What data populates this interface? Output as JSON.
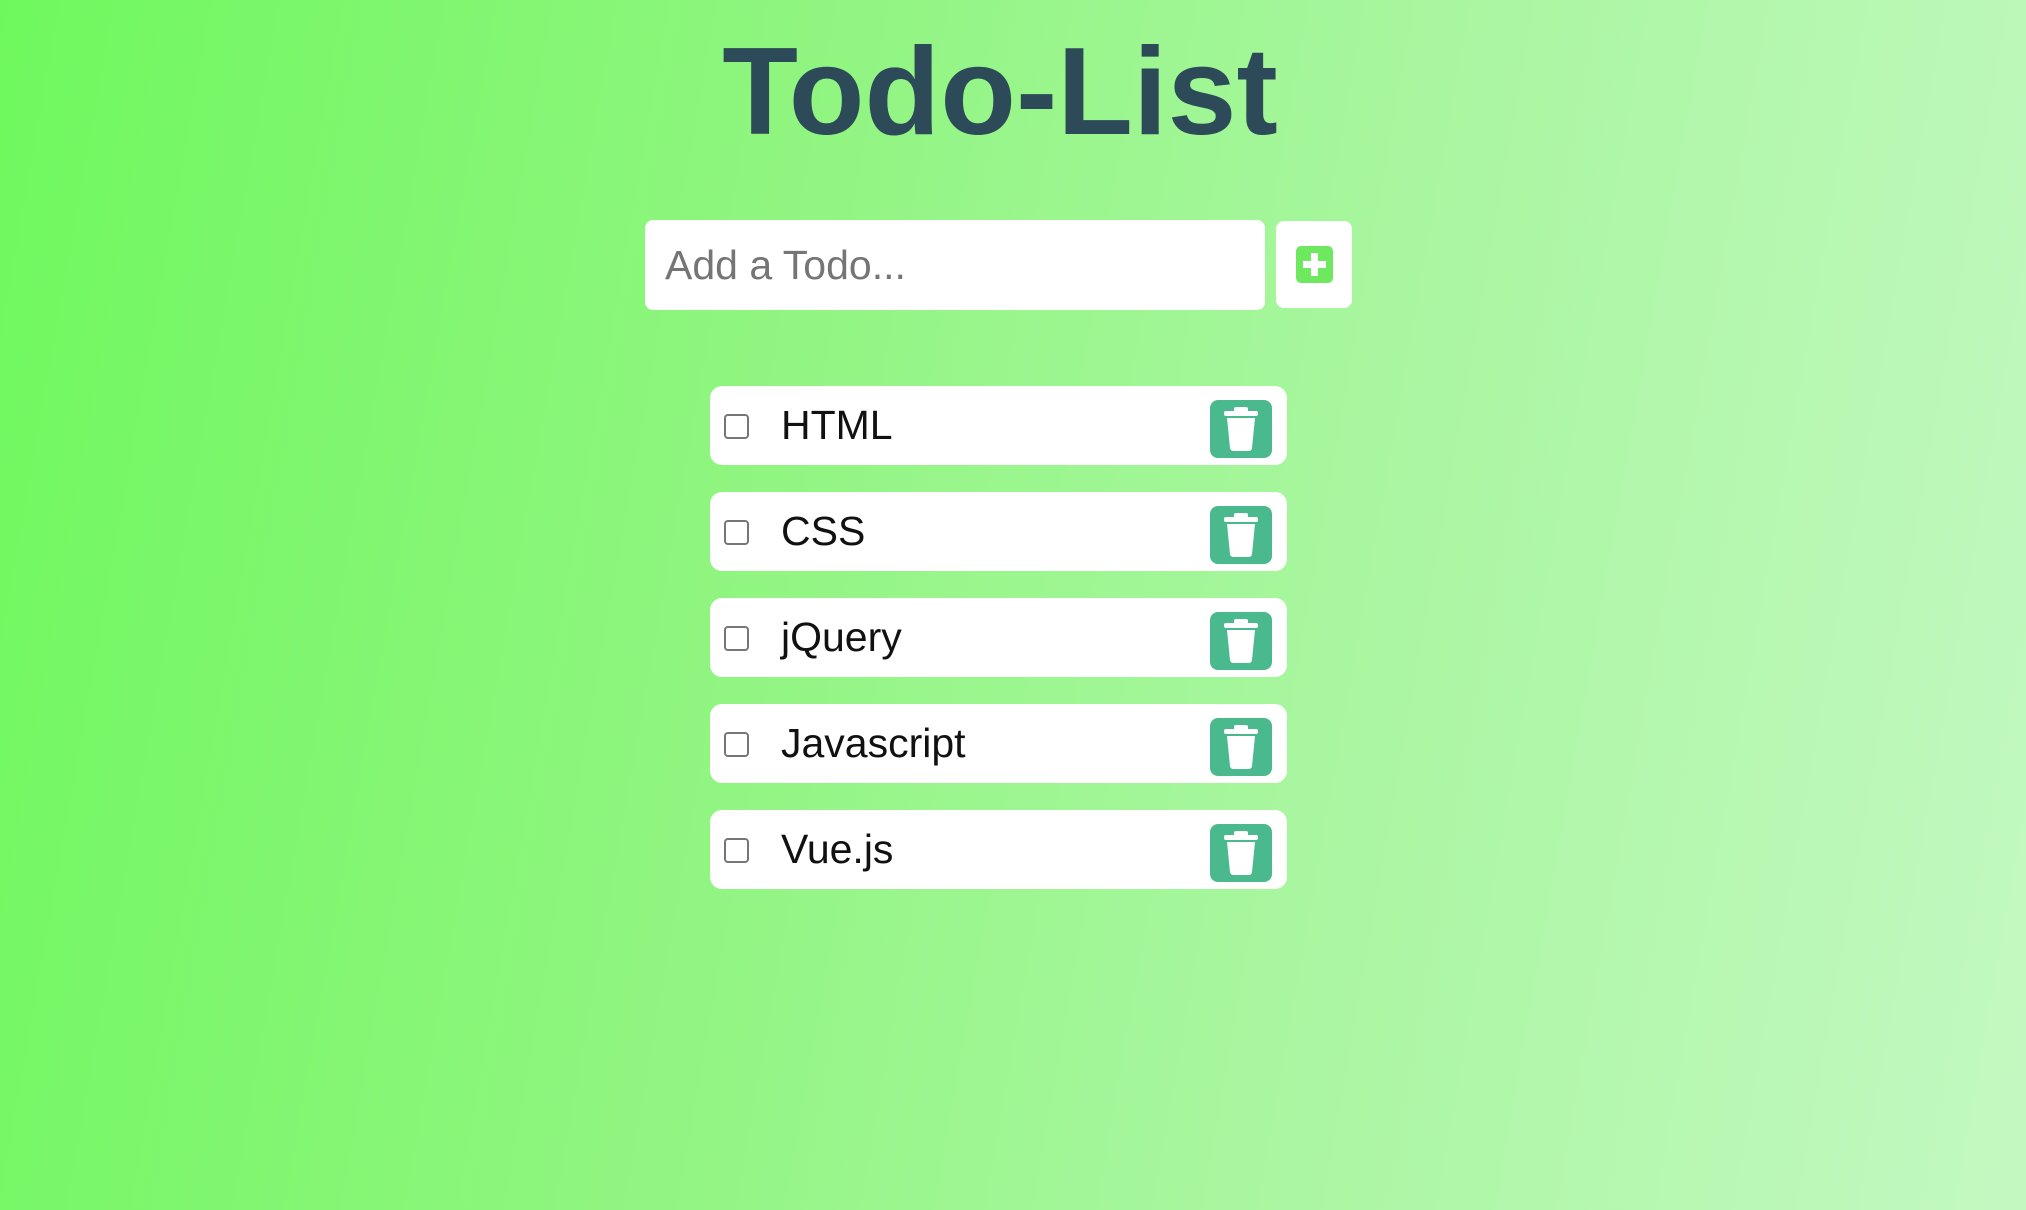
{
  "page": {
    "title": "Todo-List"
  },
  "input": {
    "placeholder": "Add a Todo...",
    "value": ""
  },
  "add_button": {
    "icon": "plus-square-icon",
    "icon_color": "#6ee85f"
  },
  "colors": {
    "title": "#2c4a57",
    "delete_button": "#4bb98e",
    "background_start": "#6ff85e",
    "background_end": "#c3f9c1"
  },
  "todos": [
    {
      "text": "HTML",
      "checked": false,
      "delete_icon": "trash-icon"
    },
    {
      "text": "CSS",
      "checked": false,
      "delete_icon": "trash-icon"
    },
    {
      "text": "jQuery",
      "checked": false,
      "delete_icon": "trash-icon"
    },
    {
      "text": "Javascript",
      "checked": false,
      "delete_icon": "trash-icon"
    },
    {
      "text": "Vue.js",
      "checked": false,
      "delete_icon": "trash-icon"
    }
  ]
}
